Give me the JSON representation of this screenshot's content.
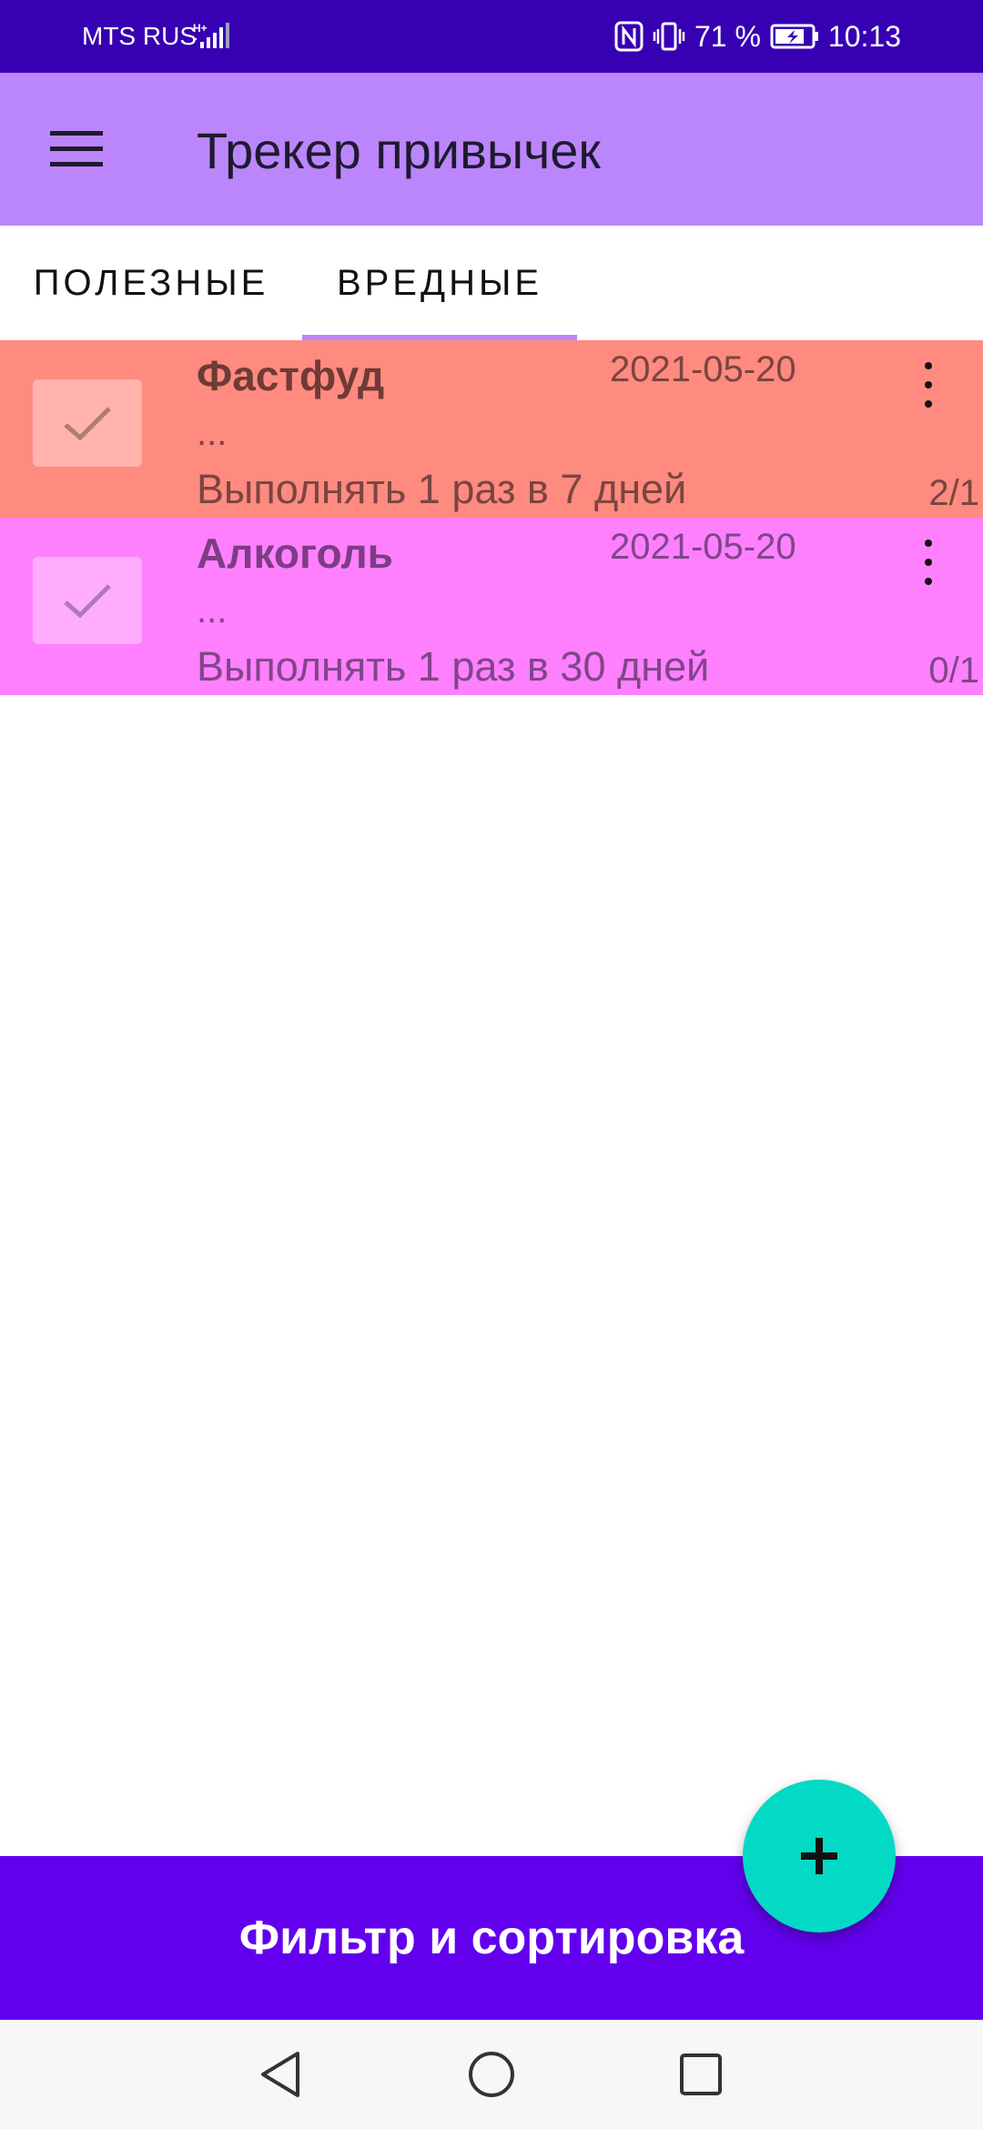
{
  "status_bar": {
    "carrier": "MTS RUS",
    "network_type": "H+",
    "battery_percent": "71 %",
    "time": "10:13"
  },
  "app_bar": {
    "title": "Трекер привычек",
    "menu_icon": "hamburger-menu-icon"
  },
  "tabs": [
    {
      "label": "ПОЛЕЗНЫЕ",
      "selected": false
    },
    {
      "label": "ВРЕДНЫЕ",
      "selected": true
    }
  ],
  "habits": [
    {
      "title": "Фастфуд",
      "date": "2021-05-20",
      "description": "...",
      "frequency": "Выполнять 1 раз в 7 дней",
      "count": "2/1",
      "color": "#ff8a80"
    },
    {
      "title": "Алкоголь",
      "date": "2021-05-20",
      "description": "...",
      "frequency": "Выполнять 1 раз в 30 дней",
      "count": "0/1",
      "color": "#ff80fe"
    }
  ],
  "filter_button": {
    "label": "Фильтр и сортировка",
    "color": "#6200ee"
  },
  "fab": {
    "icon": "plus-icon",
    "color": "#03dac5"
  },
  "colors": {
    "status_bar": "#3700b3",
    "app_bar": "#bb86fc",
    "tab_indicator": "#bb86fc"
  }
}
